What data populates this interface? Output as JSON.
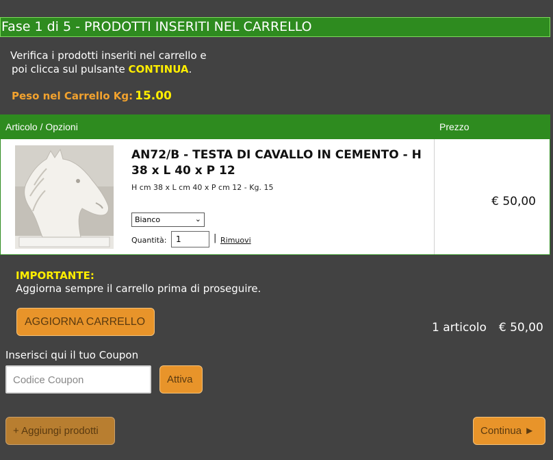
{
  "step": {
    "title": "Fase 1 di 5 - PRODOTTI INSERITI NEL CARRELLO"
  },
  "intro": {
    "line1": "Verifica i prodotti inseriti nel carrello e",
    "line2_prefix": "poi clicca sul pulsante ",
    "line2_highlight": "CONTINUA",
    "line2_suffix": "."
  },
  "weight": {
    "label": "Peso nel Carrello Kg:",
    "value": "15.00"
  },
  "cart": {
    "headers": {
      "item": "Articolo / Opzioni",
      "price": "Prezzo"
    },
    "items": [
      {
        "title": "AN72/B - TESTA DI CAVALLO IN CEMENTO - H 38 x L 40 x P 12",
        "subtitle": "H cm 38 x L cm 40 x P cm 12 - Kg. 15",
        "variant": "Bianco",
        "quantity_label": "Quantità:",
        "quantity": "1",
        "separator": "|",
        "remove_label": "Rimuovi",
        "price": "€ 50,00",
        "image_icon": "horse-head-icon"
      }
    ]
  },
  "important": {
    "title": "IMPORTANTE:",
    "text": "Aggiorna sempre il carrello prima di proseguire."
  },
  "buttons": {
    "update": "AGGIORNA CARRELLO",
    "activate": "Attiva",
    "add_products": "+ Aggiungi prodotti",
    "continue": "Continua ►"
  },
  "summary": {
    "count": "1 articolo",
    "total": "€ 50,00"
  },
  "coupon": {
    "label": "Inserisci qui il tuo Coupon",
    "placeholder": "Codice Coupon"
  },
  "colors": {
    "background": "#424242",
    "header_green": "#2e8b1f",
    "highlight_yellow": "#ffee00",
    "weight_orange": "#f2a22e",
    "button_orange": "#e8942a"
  }
}
